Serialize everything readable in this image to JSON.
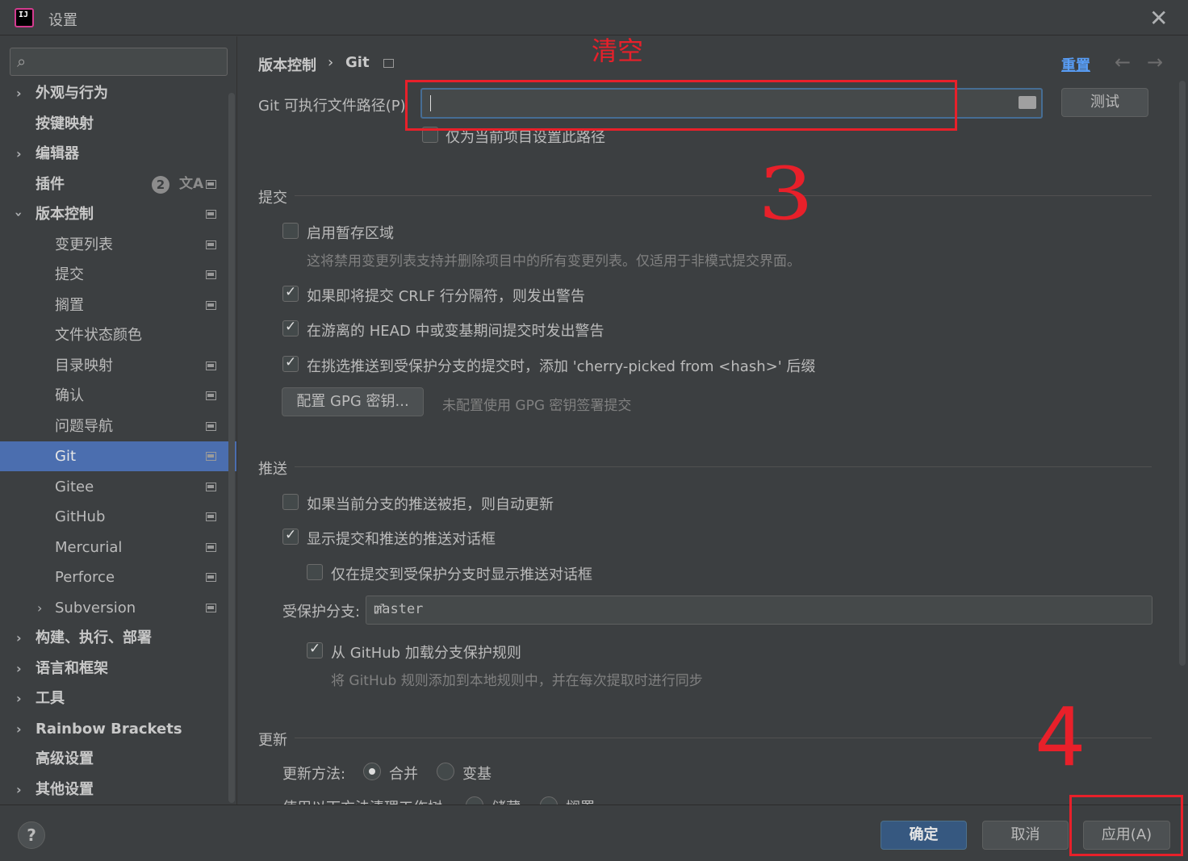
{
  "window": {
    "title": "设置",
    "app_logo_text": "IJ",
    "close": "✕"
  },
  "sidebar": {
    "search_placeholder": "",
    "items": [
      {
        "label": "外观与行为"
      },
      {
        "label": "按键映射"
      },
      {
        "label": "编辑器"
      },
      {
        "label": "插件",
        "badge": "2",
        "extra_icon": "文A"
      },
      {
        "label": "版本控制"
      },
      {
        "label": "变更列表"
      },
      {
        "label": "提交"
      },
      {
        "label": "搁置"
      },
      {
        "label": "文件状态颜色"
      },
      {
        "label": "目录映射"
      },
      {
        "label": "确认"
      },
      {
        "label": "问题导航"
      },
      {
        "label": "Git"
      },
      {
        "label": "Gitee"
      },
      {
        "label": "GitHub"
      },
      {
        "label": "Mercurial"
      },
      {
        "label": "Perforce"
      },
      {
        "label": "Subversion"
      },
      {
        "label": "构建、执行、部署"
      },
      {
        "label": "语言和框架"
      },
      {
        "label": "工具"
      },
      {
        "label": "Rainbow Brackets"
      },
      {
        "label": "高级设置"
      },
      {
        "label": "其他设置"
      }
    ]
  },
  "header": {
    "breadcrumb_parent": "版本控制",
    "breadcrumb_sep": "›",
    "breadcrumb_current": "Git",
    "reset": "重置",
    "back": "←",
    "forward": "→"
  },
  "git_path": {
    "label": "Git 可执行文件路径(P)",
    "value": "",
    "test_button": "测试",
    "project_only": "仅为当前项目设置此路径"
  },
  "commit": {
    "title": "提交",
    "staging_area": "启用暂存区域",
    "staging_hint": "这将禁用变更列表支持并删除项目中的所有变更列表。仅适用于非模式提交界面。",
    "crlf_warning": "如果即将提交 CRLF 行分隔符，则发出警告",
    "detached_head": "在游离的 HEAD 中或变基期间提交时发出警告",
    "cherry_pick": "在挑选推送到受保护分支的提交时，添加 'cherry-picked from <hash>' 后缀",
    "gpg_button": "配置 GPG 密钥...",
    "gpg_hint": "未配置使用 GPG 密钥签署提交"
  },
  "push": {
    "title": "推送",
    "auto_update": "如果当前分支的推送被拒，则自动更新",
    "show_dialog": "显示提交和推送的推送对话框",
    "protected_only": "仅在提交到受保护分支时显示推送对话框",
    "protected_label": "受保护分支:",
    "protected_value": "master",
    "load_github": "从 GitHub 加载分支保护规则",
    "load_github_hint": "将 GitHub 规则添加到本地规则中，并在每次提取时进行同步"
  },
  "update": {
    "title": "更新",
    "method_label": "更新方法:",
    "merge": "合并",
    "rebase": "变基",
    "clean_label": "使用以下方法清理工作树:",
    "stash": "储藏",
    "shelve": "搁置"
  },
  "annotations": {
    "clear": "清空",
    "three": "3",
    "four": "4"
  },
  "footer": {
    "help": "?",
    "ok": "确定",
    "cancel": "取消",
    "apply": "应用(A)"
  },
  "colors": {
    "accent": "#4b6eaf",
    "annotation": "#e8202a",
    "link": "#589df6"
  }
}
